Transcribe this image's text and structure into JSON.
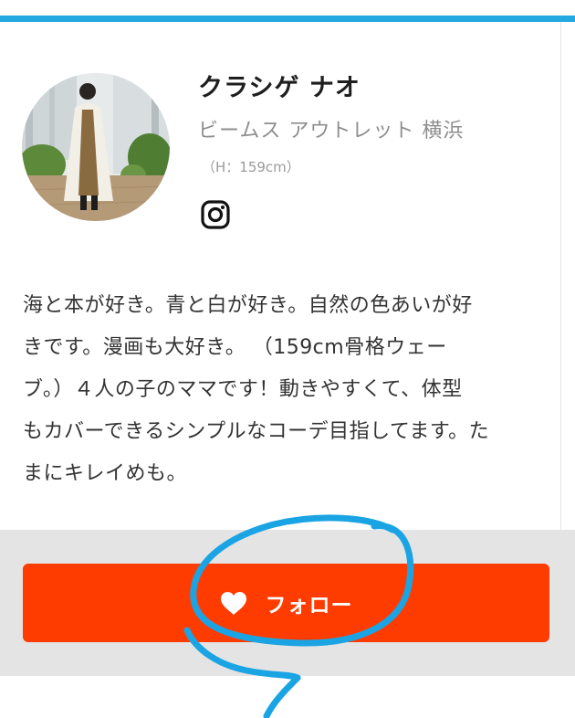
{
  "profile": {
    "name": "クラシゲ ナオ",
    "shop": "ビームス アウトレット 横浜",
    "height": "（H：159cm）",
    "social_icon": "instagram-icon"
  },
  "bio": {
    "lines": [
      "海と本が好き。青と白が好き。自然の色あいが好",
      "きです。漫画も大好き。 （159cm骨格ウェー",
      "ブ。）４人の子のママです！動きやすくて、体型",
      "もカバーできるシンプルなコーデ目指してます。た",
      "まにキレイめも。"
    ]
  },
  "follow": {
    "label": "フォロー",
    "icon": "heart-icon"
  },
  "colors": {
    "accent_bar": "#23a8e0",
    "follow_button": "#ff3c00",
    "annotation": "#1aa4e4"
  }
}
